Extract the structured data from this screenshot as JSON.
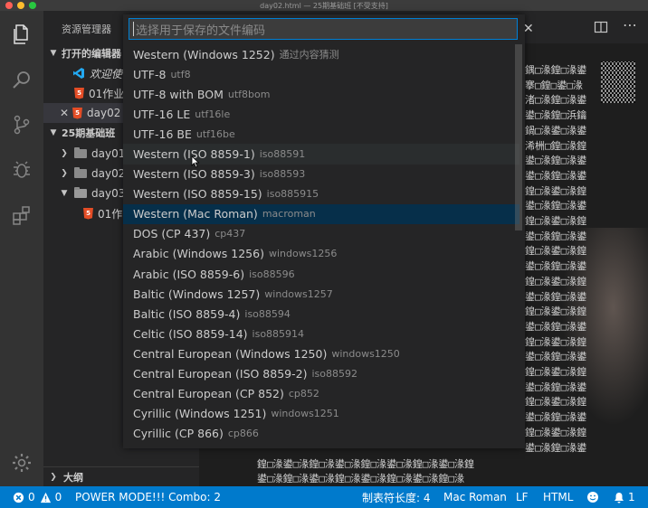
{
  "window": {
    "title": "day02.html — 25期基础班 [不受支持]"
  },
  "colors": {
    "accent": "#007acc",
    "status_bar": "#007acc",
    "quickpick_active": "#062f4a"
  },
  "sidebar": {
    "header": "资源管理器",
    "open_editors_label": "打开的编辑器",
    "open_editors": [
      {
        "label": "欢迎使",
        "icon": "vscode-icon"
      },
      {
        "label": "01作业",
        "icon": "html5-icon"
      },
      {
        "label": "day02",
        "icon": "html5-icon"
      }
    ],
    "project_label": "25期基础班",
    "folders": [
      {
        "label": "day01"
      },
      {
        "label": "day02"
      },
      {
        "label": "day03"
      }
    ],
    "nested_file": "01作",
    "outline_label": "大纲"
  },
  "quickpick": {
    "placeholder": "选择用于保存的文件编码",
    "items": [
      {
        "label": "Western (Windows 1252)",
        "desc": "通过内容猜测"
      },
      {
        "label": "UTF-8",
        "desc": "utf8"
      },
      {
        "label": "UTF-8 with BOM",
        "desc": "utf8bom"
      },
      {
        "label": "UTF-16 LE",
        "desc": "utf16le"
      },
      {
        "label": "UTF-16 BE",
        "desc": "utf16be"
      },
      {
        "label": "Western (ISO 8859-1)",
        "desc": "iso88591"
      },
      {
        "label": "Western (ISO 8859-3)",
        "desc": "iso88593"
      },
      {
        "label": "Western (ISO 8859-15)",
        "desc": "iso885915"
      },
      {
        "label": "Western (Mac Roman)",
        "desc": "macroman"
      },
      {
        "label": "DOS (CP 437)",
        "desc": "cp437"
      },
      {
        "label": "Arabic (Windows 1256)",
        "desc": "windows1256"
      },
      {
        "label": "Arabic (ISO 8859-6)",
        "desc": "iso88596"
      },
      {
        "label": "Baltic (Windows 1257)",
        "desc": "windows1257"
      },
      {
        "label": "Baltic (ISO 8859-4)",
        "desc": "iso88594"
      },
      {
        "label": "Celtic (ISO 8859-14)",
        "desc": "iso885914"
      },
      {
        "label": "Central European (Windows 1250)",
        "desc": "windows1250"
      },
      {
        "label": "Central European (ISO 8859-2)",
        "desc": "iso88592"
      },
      {
        "label": "Central European (CP 852)",
        "desc": "cp852"
      },
      {
        "label": "Cyrillic (Windows 1251)",
        "desc": "windows1251"
      },
      {
        "label": "Cyrillic (CP 866)",
        "desc": "cp866"
      }
    ]
  },
  "editor": {
    "lines": [
      "鍝□湪鍠□湪鍙",
      "搴□鍠□鍙□湪",
      "渚□湪鍠□湪鍙",
      "鍙□湪鍠□浜鑰",
      "鍋□湪鍙□湪鍙",
      "浠栦□鍠□湪鍠",
      "鍙□湪鍠□湪鍙",
      "鍙□湪鍠□湪鍙",
      "鍠□湪鍙□湪鍠",
      "鍙□湪鍠□湪鍙",
      "鍠□湪鍙□湪鍠",
      "鍙□湪鍠□湪鍙",
      "鍠□湪鍙□湪鍠",
      "鍙□湪鍠□湪鍙",
      "鍠□湪鍙□湪鍠",
      "鍙□湪鍠□湪鍙",
      "鍠□湪鍙□湪鍠",
      "鍙□湪鍠□湪鍙",
      "鍠□湪鍙□湪鍠",
      "鍙□湪鍠□湪鍙",
      "鍠□湪鍙□湪鍠",
      "鍙□湪鍠□湪鍙",
      "鍠□湪鍙□湪鍠",
      "鍙□湪鍠□湪鍙",
      "鍠□湪鍙□湪鍠",
      "鍙□湪鍠□湪鍙"
    ],
    "bottom_lines": [
      "鍠□湪鍙□湪鍠□湪鍙□湪鍠□湪鍙□湪鍠□湪鍙□湪鍠",
      "鍙□湪鍠□湪鍙□湪鍠□湪鍙□湪鍠□湪鍙□湪鍠□湪"
    ]
  },
  "statusbar": {
    "errors": "0",
    "warnings": "0",
    "power_mode": "POWER MODE!!! Combo: 2",
    "indent": "制表符长度: 4",
    "encoding": "Mac Roman",
    "eol": "LF",
    "language": "HTML",
    "notifications": "1"
  }
}
